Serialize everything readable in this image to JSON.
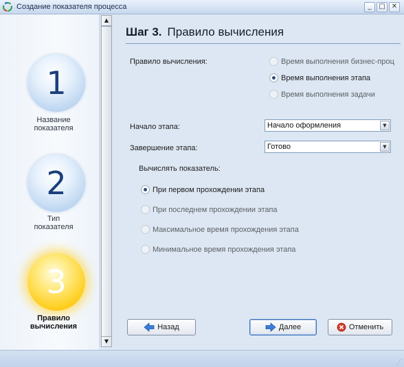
{
  "window": {
    "title": "Создание показателя процесса",
    "minimize": "_",
    "maximize": "□",
    "close": "✕"
  },
  "steps": [
    {
      "number": "1",
      "label_line1": "Название",
      "label_line2": "показателя"
    },
    {
      "number": "2",
      "label_line1": "Тип",
      "label_line2": "показателя"
    },
    {
      "number": "3",
      "label_line1": "Правило",
      "label_line2": "вычисления"
    }
  ],
  "scrollbar": {
    "up": "▲",
    "down": "▼"
  },
  "header": {
    "step": "Шаг 3.",
    "title": "Правило вычисления"
  },
  "form": {
    "rule_label": "Правило вычисления:",
    "rule_options": [
      {
        "label": "Время выполнения бизнес-проц",
        "selected": false
      },
      {
        "label": "Время выполнения этапа",
        "selected": true
      },
      {
        "label": "Время выполнения задачи",
        "selected": false
      }
    ],
    "start_label": "Начало этапа:",
    "start_value": "Начало оформления",
    "end_label": "Завершение этапа:",
    "end_value": "Готово",
    "dropdown_arrow": "▼",
    "calc_label": "Вычислять показатель:",
    "calc_options": [
      {
        "label": "При первом прохождении этапа",
        "selected": true
      },
      {
        "label": "При последнем прохождении этапа",
        "selected": false
      },
      {
        "label": "Максимальное время прохождения этапа",
        "selected": false
      },
      {
        "label": "Минимальное время прохождения этапа",
        "selected": false
      }
    ]
  },
  "buttons": {
    "back": "Назад",
    "next": "Далее",
    "cancel": "Отменить"
  },
  "icons": {
    "app": "app-logo-icon",
    "back": "arrow-left-icon",
    "next": "arrow-right-icon",
    "cancel": "cancel-circle-icon"
  },
  "colors": {
    "active_step": "#ffcf22",
    "inactive_step": "#bcd5f0",
    "content_bg": "#dde7f3",
    "arrow_blue": "#3b7dd8",
    "cancel_red": "#d23a2a"
  }
}
